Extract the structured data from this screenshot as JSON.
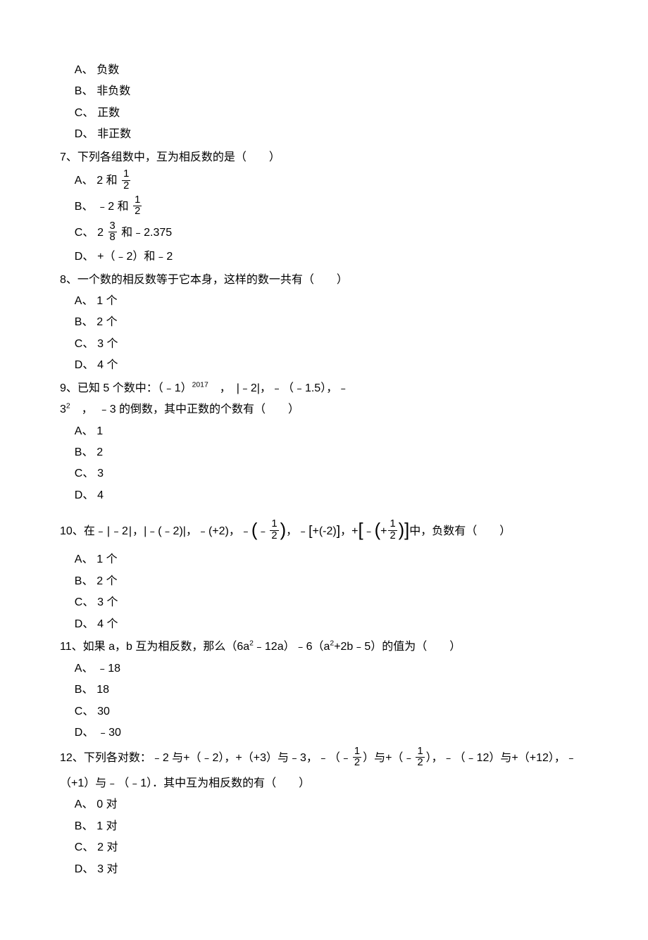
{
  "orphan_opts": [
    {
      "l": "A、",
      "t": "负数"
    },
    {
      "l": "B、",
      "t": "非负数"
    },
    {
      "l": "C、",
      "t": "正数"
    },
    {
      "l": "D、",
      "t": "非正数"
    }
  ],
  "q7": {
    "num": "7、",
    "text": "下列各组数中，互为相反数的是（　　）",
    "a": {
      "l": "A、",
      "pre": "2 和 "
    },
    "b": {
      "l": "B、",
      "pre": "﹣2 和 "
    },
    "c": {
      "l": "C、",
      "pre": "2 ",
      " mid": " 和﹣2.375"
    },
    "d": {
      "l": "D、",
      "t": "+（﹣2）和﹣2"
    }
  },
  "half_n": "1",
  "half_d": "2",
  "f38_n": "3",
  "f38_d": "8",
  "q8": {
    "num": "8、",
    "text": "一个数的相反数等于它本身，这样的数一共有（　　）",
    "opts": [
      {
        "l": "A、",
        "t": "1 个"
      },
      {
        "l": "B、",
        "t": "2 个"
      },
      {
        "l": "C、",
        "t": "3 个"
      },
      {
        "l": "D、",
        "t": "4 个"
      }
    ]
  },
  "q9": {
    "num": "9、",
    "pre": "已知 5 个数中：（﹣1）",
    "exp1": "2017",
    "mid1": "　，　|﹣2|，﹣（﹣1.5），﹣3",
    "exp2": "2",
    "tail": "　，　﹣3 的倒数，其中正数的个数有（　　）",
    "opts": [
      {
        "l": "A、",
        "t": "1"
      },
      {
        "l": "B、",
        "t": "2"
      },
      {
        "l": "C、",
        "t": "3"
      },
      {
        "l": "D、",
        "t": "4"
      }
    ]
  },
  "q10": {
    "num": "10、",
    "pre": "在﹣",
    "t1": "﹣2",
    "t2": "，",
    "g1_pre": "|",
    "g1": "﹣(﹣2)",
    "g1_post": "|",
    "g2_pre": "，﹣(",
    "g2": "+2",
    "g2_post": ")",
    "g3_pre": "，﹣",
    "g3_l": "(",
    "g3_in_pre": "﹣",
    "g3_r": ")",
    "g4_pre": "，﹣",
    "g4_l": "[",
    "g4_in": "+(-2)",
    "g4_r": "]",
    "g5_pre": "，+",
    "g5_l": "[",
    "g5_in_pre": "﹣",
    "g5_in_l": "(",
    "g5_in_in_pre": "+",
    "g5_in_r": ")",
    "g5_r": "]",
    "tail": "中，负数有（　　）",
    "opts": [
      {
        "l": "A、",
        "t": "1 个"
      },
      {
        "l": "B、",
        "t": "2 个"
      },
      {
        "l": "C、",
        "t": "3 个"
      },
      {
        "l": "D、",
        "t": "4 个"
      }
    ]
  },
  "q11": {
    "num": "11、",
    "pre": "如果 a，b 互为相反数，那么（6a",
    "sq1": "2",
    "mid1": "﹣12a）﹣6（a",
    "sq2": "2",
    "tail": "+2b﹣5）的值为（　　）",
    "opts": [
      {
        "l": "A、",
        "t": "﹣18"
      },
      {
        "l": "B、",
        "t": "18"
      },
      {
        "l": "C、",
        "t": "30"
      },
      {
        "l": "D、",
        "t": "﹣30"
      }
    ]
  },
  "q12": {
    "num": "12、",
    "line1_pre": "下列各对数：﹣2 与+（﹣2），+（+3）与﹣3，﹣（﹣",
    "line1_mid": "）与+（﹣",
    "line1_post": "），﹣（﹣12）与+（+12），﹣",
    "line2": "（+1）与﹣（﹣1）．其中互为相反数的有（　　）",
    "opts": [
      {
        "l": "A、",
        "t": "0 对"
      },
      {
        "l": "B、",
        "t": "1 对"
      },
      {
        "l": "C、",
        "t": "2 对"
      },
      {
        "l": "D、",
        "t": "3 对"
      }
    ]
  }
}
